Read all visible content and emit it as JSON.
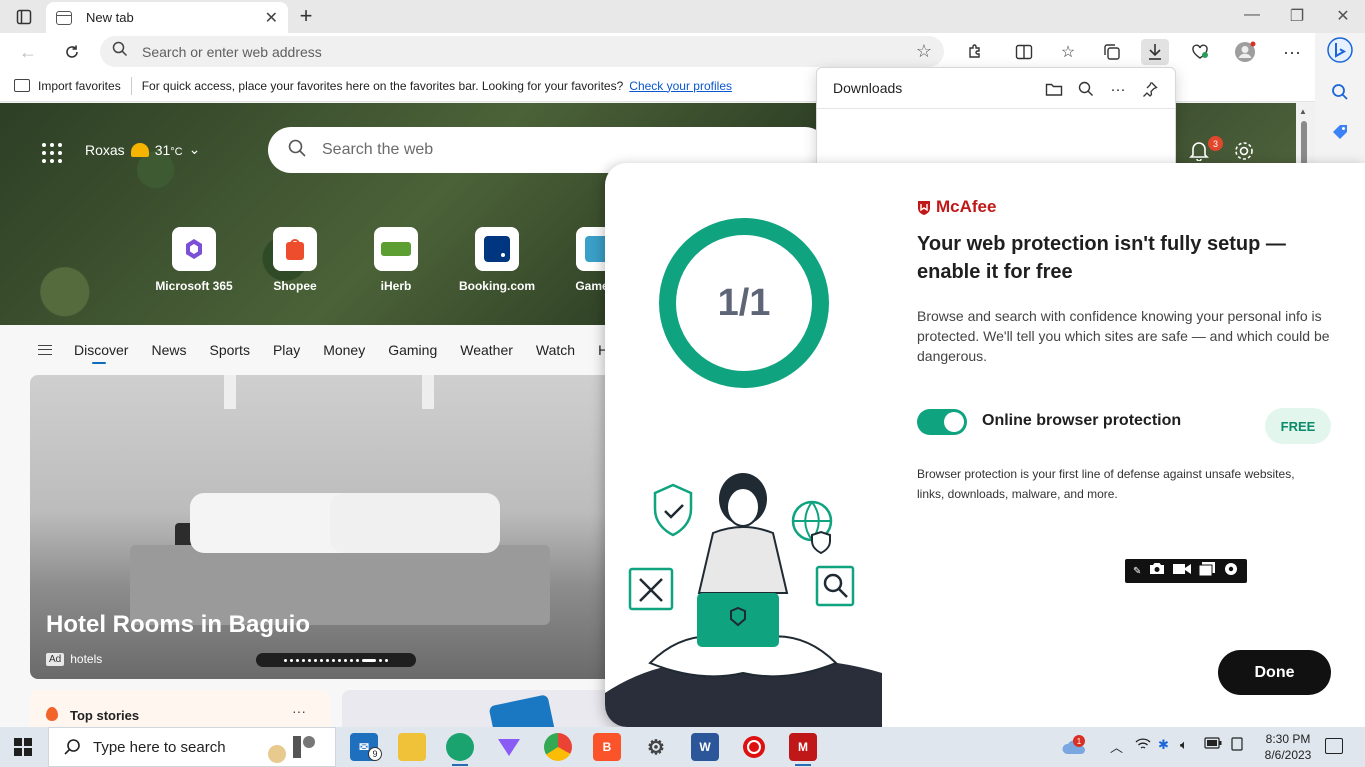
{
  "browser": {
    "tab_title": "New tab",
    "address_placeholder": "Search or enter web address",
    "favorites_bar": {
      "import_label": "Import favorites",
      "message": "For quick access, place your favorites here on the favorites bar. Looking for your favorites?",
      "link": "Check your profiles"
    }
  },
  "downloads": {
    "title": "Downloads"
  },
  "ntp": {
    "weather": {
      "location": "Roxas",
      "temp": "31",
      "unit": "°C"
    },
    "search_placeholder": "Search the web",
    "notification_count": "3",
    "quick_links": [
      {
        "label": "Microsoft 365",
        "color": "#7b4fd6"
      },
      {
        "label": "Shopee",
        "color": "#ee4d2d"
      },
      {
        "label": "iHerb",
        "color": "#5c9e31"
      },
      {
        "label": "Booking.com",
        "color": "#003580"
      },
      {
        "label": "Game C",
        "color": "#3aa0c8"
      }
    ],
    "feed_tabs": [
      "Discover",
      "News",
      "Sports",
      "Play",
      "Money",
      "Gaming",
      "Weather",
      "Watch",
      "H"
    ],
    "hero_card": {
      "title": "Hotel Rooms in Baguio",
      "ad_badge": "Ad",
      "source": "hotels"
    },
    "top_stories_label": "Top stories",
    "top_stories_more": "···"
  },
  "mcafee": {
    "brand": "McAfee",
    "counter": "1/1",
    "heading": "Your web protection isn't fully setup — enable it for free",
    "description": "Browse and search with confidence knowing your personal info is protected. We'll tell you which sites are safe — and which could be dangerous.",
    "toggle_label": "Online browser protection",
    "toggle_on": true,
    "badge": "FREE",
    "fine_print": "Browser protection is your first line of defense against unsafe websites, links, downloads, malware, and more.",
    "done_label": "Done",
    "accent_color": "#0fa37f",
    "brand_color": "#c01818"
  },
  "taskbar": {
    "search_placeholder": "Type here to search",
    "mail_badge": "9",
    "weather_badge": "1",
    "time": "8:30 PM",
    "date": "8/6/2023"
  }
}
